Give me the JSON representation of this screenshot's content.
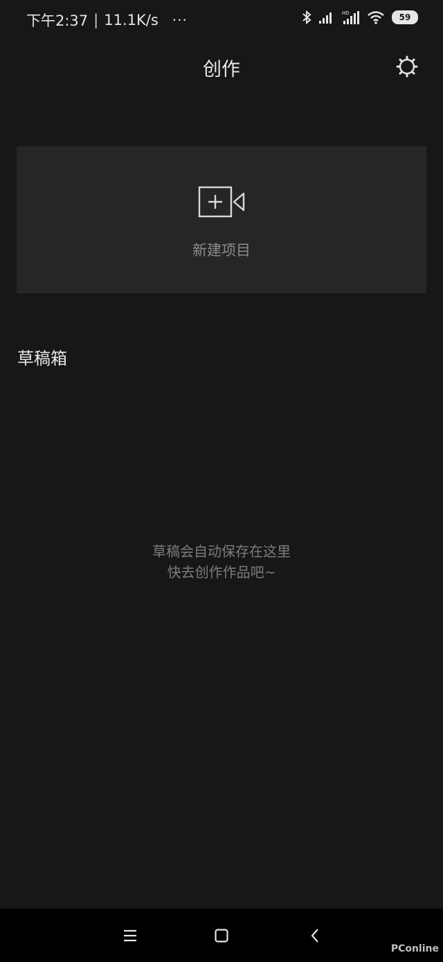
{
  "status_bar": {
    "time": "下午2:37",
    "separator": "|",
    "network_speed": "11.1K/s",
    "more": "···",
    "battery_level": "59",
    "icons": [
      "bluetooth-icon",
      "signal-icon",
      "hd-signal-icon",
      "wifi-icon",
      "battery-icon"
    ]
  },
  "header": {
    "title": "创作",
    "settings_icon": "settings-icon"
  },
  "new_project": {
    "icon": "video-add-icon",
    "label": "新建项目"
  },
  "drafts": {
    "title": "草稿箱",
    "empty_line1": "草稿会自动保存在这里",
    "empty_line2": "快去创作作品吧~"
  },
  "nav_bar": {
    "icons": [
      "menu-icon",
      "home-icon",
      "back-icon"
    ]
  },
  "watermark": "PConline",
  "colors": {
    "background": "#171717",
    "card": "#262626",
    "nav": "#000000"
  }
}
